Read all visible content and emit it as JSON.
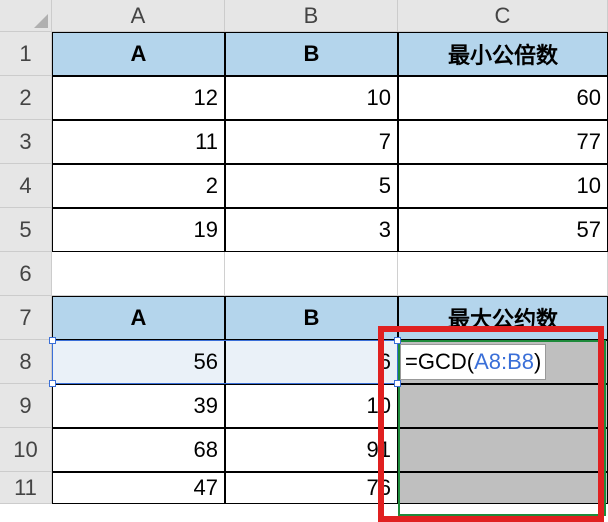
{
  "col_headers": {
    "A": "A",
    "B": "B",
    "C": "C"
  },
  "row_headers": [
    "1",
    "2",
    "3",
    "4",
    "5",
    "6",
    "7",
    "8",
    "9",
    "10",
    "11"
  ],
  "table1": {
    "headers": {
      "A": "A",
      "B": "B",
      "C": "最小公倍数"
    },
    "rows": [
      {
        "a": "12",
        "b": "10",
        "c": "60"
      },
      {
        "a": "11",
        "b": "7",
        "c": "77"
      },
      {
        "a": "2",
        "b": "5",
        "c": "10"
      },
      {
        "a": "19",
        "b": "3",
        "c": "57"
      }
    ]
  },
  "table2": {
    "headers": {
      "A": "A",
      "B": "B",
      "C": "最大公约数"
    },
    "rows": [
      {
        "a": "56",
        "b": "6"
      },
      {
        "a": "39",
        "b": "10"
      },
      {
        "a": "68",
        "b": "91"
      },
      {
        "a": "47",
        "b": "76"
      }
    ]
  },
  "formula": {
    "prefix": "=GCD(",
    "ref": "A8:B8",
    "suffix": ")"
  }
}
